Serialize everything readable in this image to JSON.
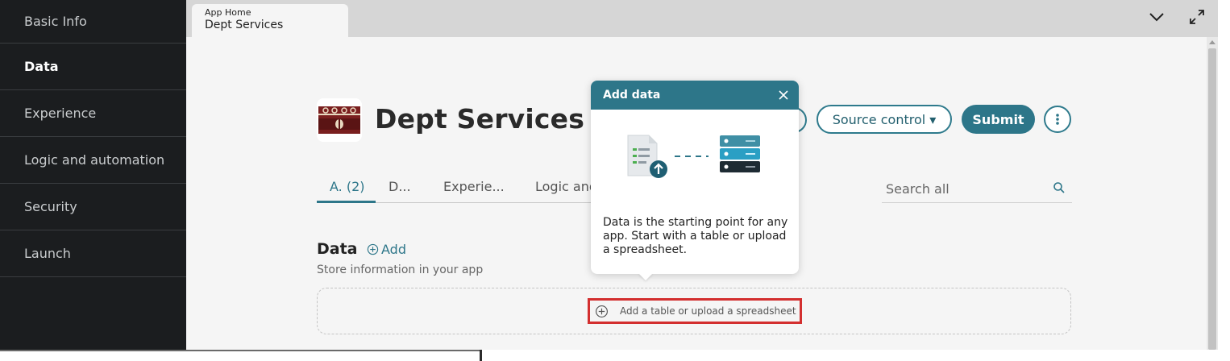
{
  "sidebar": {
    "items": [
      {
        "label": "Basic Info"
      },
      {
        "label": "Data"
      },
      {
        "label": "Experience"
      },
      {
        "label": "Logic and automation"
      },
      {
        "label": "Security"
      },
      {
        "label": "Launch"
      }
    ],
    "active_index": 1
  },
  "tab": {
    "breadcrumb": "App Home",
    "title": "Dept Services"
  },
  "window_controls": {
    "collapse_icon": "chevron-down-icon",
    "expand_icon": "expand-icon"
  },
  "header": {
    "title": "Dept Services",
    "source_control_label": "Source control ▾",
    "submit_label": "Submit"
  },
  "subtabs": [
    {
      "label": "A. (2)"
    },
    {
      "label": "D..."
    },
    {
      "label": "Experie..."
    },
    {
      "label": "Logic and"
    }
  ],
  "search": {
    "placeholder": "Search all"
  },
  "data_section": {
    "heading": "Data",
    "add_label": "Add",
    "subtitle": "Store information in your app",
    "dropzone_action": "Add a table or upload a spreadsheet"
  },
  "popover": {
    "title": "Add data",
    "body": "Data is the starting point for any app. Start with a table or upload a spreadsheet."
  },
  "colors": {
    "accent": "#2d7689",
    "sidebar_bg": "#1b1d1f",
    "highlight": "#d32f2f"
  }
}
